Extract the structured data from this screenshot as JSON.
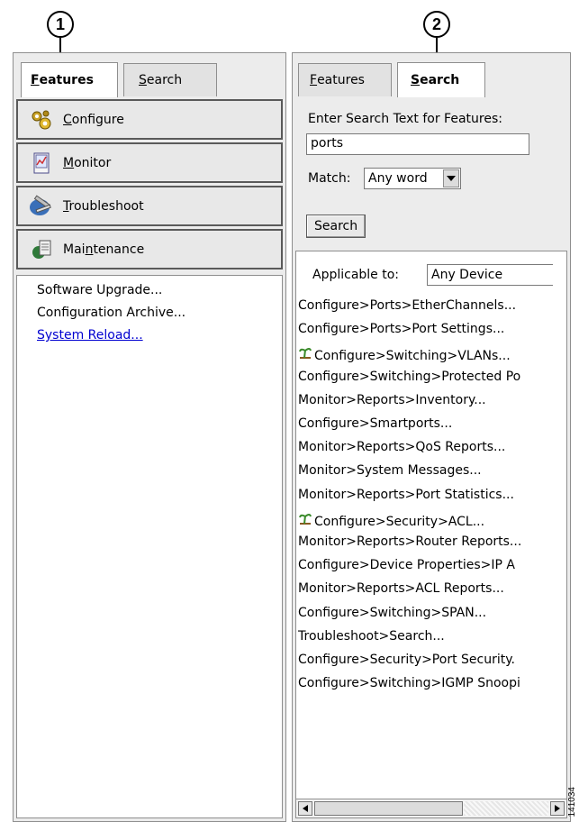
{
  "callouts": {
    "one": "1",
    "two": "2"
  },
  "left": {
    "tabs": {
      "features": {
        "pre": "",
        "u": "F",
        "post": "eatures"
      },
      "search": {
        "pre": "",
        "u": "S",
        "post": "earch"
      }
    },
    "buttons": [
      {
        "pre": "",
        "u": "C",
        "post": "onfigure",
        "icon": "gears-icon"
      },
      {
        "pre": "",
        "u": "M",
        "post": "onitor",
        "icon": "monitor-chart-icon"
      },
      {
        "pre": "",
        "u": "T",
        "post": "roubleshoot",
        "icon": "tools-icon"
      },
      {
        "pre": "Mai",
        "u": "n",
        "post": "tenance",
        "icon": "maintenance-icon"
      }
    ],
    "items": [
      "Software Upgrade...",
      "Configuration Archive...",
      "System Reload..."
    ]
  },
  "right": {
    "tabs": {
      "features": {
        "pre": "",
        "u": "F",
        "post": "eatures"
      },
      "search": {
        "pre": "",
        "u": "S",
        "post": "earch"
      }
    },
    "search_prompt": "Enter Search Text for Features:",
    "search_value": "ports",
    "match_label": "Match:",
    "match_value": "Any word",
    "search_button": "Search",
    "applicable_label": "Applicable to:",
    "applicable_value": "Any Device",
    "results": [
      {
        "text": "Configure>Ports>EtherChannels...",
        "icon": false
      },
      {
        "text": "Configure>Ports>Port Settings...",
        "icon": false
      },
      {
        "text": "Configure>Switching>VLANs...",
        "icon": true
      },
      {
        "text": "Configure>Switching>Protected Po",
        "icon": false
      },
      {
        "text": "Monitor>Reports>Inventory...",
        "icon": false
      },
      {
        "text": "Configure>Smartports...",
        "icon": false
      },
      {
        "text": "Monitor>Reports>QoS Reports...",
        "icon": false
      },
      {
        "text": "Monitor>System Messages...",
        "icon": false
      },
      {
        "text": "Monitor>Reports>Port Statistics...",
        "icon": false
      },
      {
        "text": "Configure>Security>ACL...",
        "icon": true
      },
      {
        "text": "Monitor>Reports>Router Reports...",
        "icon": false
      },
      {
        "text": "Configure>Device Properties>IP A",
        "icon": false
      },
      {
        "text": "Monitor>Reports>ACL Reports...",
        "icon": false
      },
      {
        "text": "Configure>Switching>SPAN...",
        "icon": false
      },
      {
        "text": "Troubleshoot>Search...",
        "icon": false
      },
      {
        "text": "Configure>Security>Port Security.",
        "icon": false
      },
      {
        "text": "Configure>Switching>IGMP Snoopi",
        "icon": false
      }
    ]
  },
  "figure_code": "141034"
}
